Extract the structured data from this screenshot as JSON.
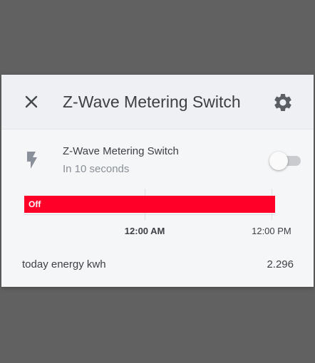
{
  "dialog": {
    "title": "Z-Wave Metering Switch",
    "close_icon": "close-icon",
    "settings_icon": "gear-icon"
  },
  "entity": {
    "icon": "flash-icon",
    "name": "Z-Wave Metering Switch",
    "secondary": "In 10 seconds",
    "state": "off"
  },
  "timeline": {
    "segments": [
      {
        "label": "Off",
        "start_fraction": 0.0,
        "end_fraction": 1.0,
        "color": "#ff0029"
      }
    ],
    "ticks": [
      {
        "label": "12:00 AM",
        "fraction": 0.445,
        "bold": true
      },
      {
        "label": "12:00 PM",
        "fraction": 0.913,
        "bold": false
      }
    ]
  },
  "attributes": [
    {
      "name": "today energy kwh",
      "value": "2.296"
    }
  ]
}
